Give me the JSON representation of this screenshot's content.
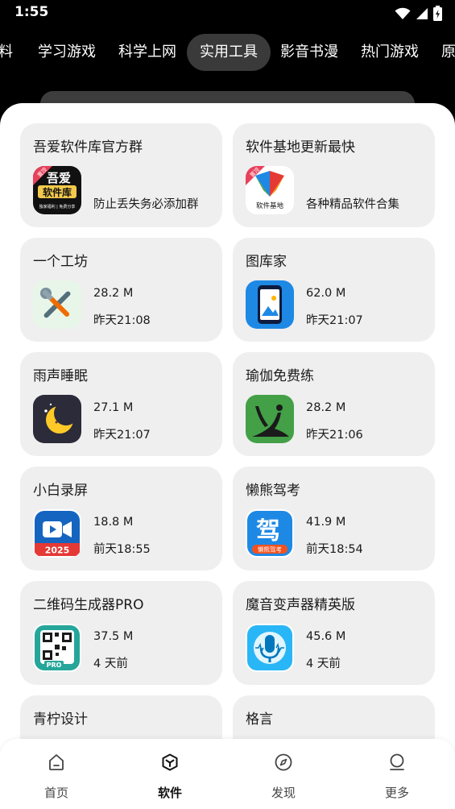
{
  "status_bar": {
    "time": "1:55"
  },
  "tabs": [
    {
      "label": "料"
    },
    {
      "label": "学习游戏"
    },
    {
      "label": "科学上网"
    },
    {
      "label": "实用工具",
      "active": true
    },
    {
      "label": "影音书漫"
    },
    {
      "label": "热门游戏"
    },
    {
      "label": "原"
    }
  ],
  "cards": [
    {
      "title": "吾爱软件库官方群",
      "desc": "防止丢失务必添加群",
      "icon": "wuai-software-icon",
      "badge": "置顶",
      "icon_text": [
        "吾爱",
        "软件库",
        "独家福利 | 免费分享"
      ]
    },
    {
      "title": "软件基地更新最快",
      "desc": "各种精品软件合集",
      "icon": "software-base-icon",
      "badge": "置顶",
      "icon_text": [
        "软件基地"
      ]
    },
    {
      "title": "一个工坊",
      "size": "28.2 M",
      "time": "昨天21:08",
      "icon": "tools-icon"
    },
    {
      "title": "图库家",
      "size": "62.0 M",
      "time": "昨天21:07",
      "icon": "gallery-phone-icon"
    },
    {
      "title": "雨声睡眠",
      "size": "27.1 M",
      "time": "昨天21:07",
      "icon": "moon-icon"
    },
    {
      "title": "瑜伽免费练",
      "size": "28.2 M",
      "time": "昨天21:06",
      "icon": "yoga-icon"
    },
    {
      "title": "小白录屏",
      "size": "18.8 M",
      "time": "前天18:55",
      "icon": "video-camera-icon",
      "icon_text": [
        "2025"
      ]
    },
    {
      "title": "懒熊驾考",
      "size": "41.9 M",
      "time": "前天18:54",
      "icon": "driving-exam-icon",
      "icon_text": [
        "驾",
        "懒熊驾考"
      ]
    },
    {
      "title": "二维码生成器PRO",
      "size": "37.5 M",
      "time": "4 天前",
      "icon": "qr-code-icon",
      "icon_text": [
        "PRO"
      ]
    },
    {
      "title": "魔音变声器精英版",
      "size": "45.6 M",
      "time": "4 天前",
      "icon": "microphone-icon"
    },
    {
      "title": "青柠设计"
    },
    {
      "title": "格言"
    }
  ],
  "bottom_nav": [
    {
      "label": "首页",
      "icon": "home-icon"
    },
    {
      "label": "软件",
      "icon": "cube-icon",
      "active": true
    },
    {
      "label": "发现",
      "icon": "compass-icon"
    },
    {
      "label": "更多",
      "icon": "person-icon"
    }
  ],
  "colors": {
    "background": "#000000",
    "sheet": "#ffffff",
    "card": "#efefef",
    "active_tab": "#3a3a3a",
    "badge": "#e8415b"
  }
}
